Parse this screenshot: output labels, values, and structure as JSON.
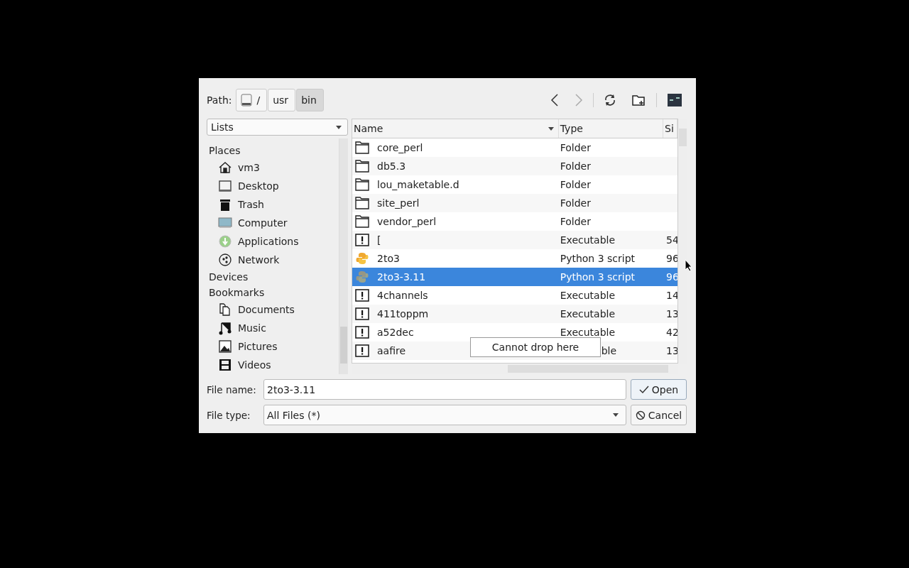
{
  "path": {
    "label": "Path:",
    "segments": [
      {
        "label": "/",
        "kind": "drive",
        "selected": false
      },
      {
        "label": "usr",
        "kind": "plain",
        "selected": false
      },
      {
        "label": "bin",
        "kind": "plain",
        "selected": true
      }
    ]
  },
  "view_mode": {
    "value": "Lists"
  },
  "places": [
    {
      "label": "Places",
      "children": [
        {
          "label": "vm3",
          "kind": "home"
        },
        {
          "label": "Desktop",
          "kind": "desktop"
        },
        {
          "label": "Trash",
          "kind": "trash"
        },
        {
          "label": "Computer",
          "kind": "computer"
        },
        {
          "label": "Applications",
          "kind": "apps"
        },
        {
          "label": "Network",
          "kind": "network"
        }
      ]
    },
    {
      "label": "Devices"
    },
    {
      "label": "Bookmarks",
      "children": [
        {
          "label": "Documents",
          "kind": "documents"
        },
        {
          "label": "Music",
          "kind": "music"
        },
        {
          "label": "Pictures",
          "kind": "pictures"
        },
        {
          "label": "Videos",
          "kind": "videos"
        }
      ]
    }
  ],
  "table": {
    "columns": [
      "Name",
      "Type",
      "Si"
    ],
    "rows": [
      {
        "name": "core_perl",
        "type": "Folder",
        "kind": "folder",
        "selected": false
      },
      {
        "name": "db5.3",
        "type": "Folder",
        "kind": "folder",
        "selected": false
      },
      {
        "name": "lou_maketable.d",
        "type": "Folder",
        "kind": "folder",
        "selected": false
      },
      {
        "name": "site_perl",
        "type": "Folder",
        "kind": "folder",
        "selected": false
      },
      {
        "name": "vendor_perl",
        "type": "Folder",
        "kind": "folder",
        "selected": false
      },
      {
        "name": "[",
        "type": "Executable",
        "size": "54",
        "kind": "exec",
        "selected": false
      },
      {
        "name": "2to3",
        "type": "Python 3 script",
        "size": "96",
        "kind": "python",
        "selected": false
      },
      {
        "name": "2to3-3.11",
        "type": "Python 3 script",
        "size": "96",
        "kind": "python",
        "selected": true
      },
      {
        "name": "4channels",
        "type": "Executable",
        "size": "14",
        "kind": "exec",
        "selected": false
      },
      {
        "name": "411toppm",
        "type": "Executable",
        "size": "13",
        "kind": "exec",
        "selected": false
      },
      {
        "name": "a52dec",
        "type": "Executable",
        "size": "42",
        "kind": "exec",
        "selected": false
      },
      {
        "name": "aafire",
        "type": "ble",
        "size": "13",
        "kind": "exec",
        "covered": true,
        "selected": false
      }
    ]
  },
  "tooltip": "Cannot drop here",
  "file_name": {
    "label": "File name:",
    "value": "2to3-3.11"
  },
  "file_type": {
    "label": "File type:",
    "value": "All Files (*)"
  },
  "buttons": [
    {
      "label": "Open",
      "kind": "open"
    },
    {
      "label": "Cancel",
      "kind": "cancel"
    }
  ]
}
